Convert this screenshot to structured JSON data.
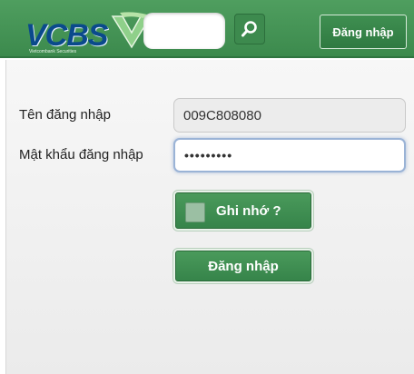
{
  "header": {
    "logo_text": "VCBS",
    "logo_subtitle": "Vietcombank Securities",
    "search": {
      "value": "",
      "placeholder": ""
    },
    "login_button_label": "Đăng nhập",
    "search_icon": "search-icon",
    "colors": {
      "header_bg": "#3f8d50",
      "logo_blue": "#0a4a8c",
      "button_green": "#3a8a4c"
    }
  },
  "form": {
    "username": {
      "label": "Tên đăng nhập",
      "value": "009C808080"
    },
    "password": {
      "label": "Mật khẩu đăng nhập",
      "value": "•••••••••"
    },
    "remember": {
      "label": "Ghi nhớ ?",
      "checked": false
    },
    "submit_label": "Đăng nhập"
  }
}
